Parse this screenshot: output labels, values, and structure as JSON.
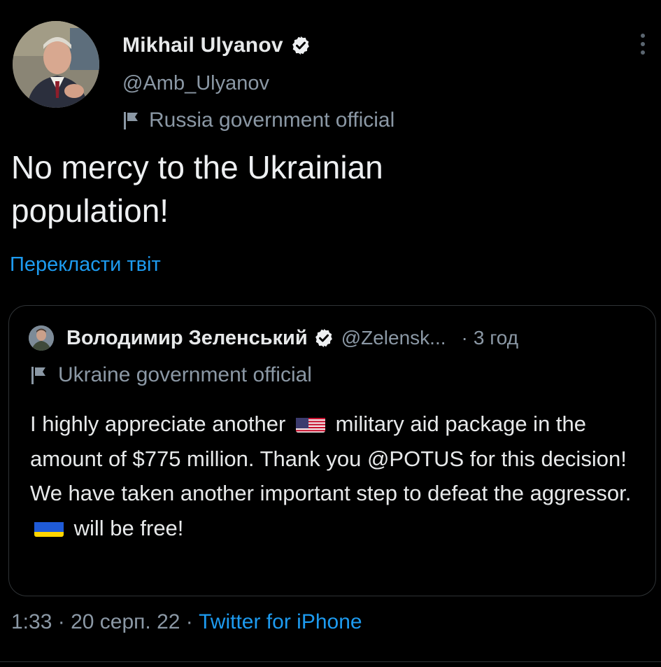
{
  "tweet": {
    "author": {
      "name": "Mikhail Ulyanov",
      "handle": "@Amb_Ulyanov",
      "label": "Russia government official",
      "avatar_icon": "portrait-man-suit"
    },
    "more_icon": "more-vertical-icon",
    "text_lines": [
      "No mercy to the Ukrainian",
      "population!"
    ],
    "translate": "Перекласти твіт",
    "quote": {
      "author": {
        "name": "Володимир Зеленський",
        "handle": "@Zelensk...",
        "label": "Ukraine government official"
      },
      "separator": "·",
      "time": "3 год",
      "text": {
        "p1": "I highly appreciate another",
        "flag_us": "us-flag-emoji",
        "p2": "military aid package in the amount of $775 million. Thank you @POTUS for this decision! We have taken another important step to defeat the aggressor.",
        "flag_ua": "ukraine-flag-emoji",
        "p3": "will be free!"
      }
    },
    "footer": {
      "time": "1:33",
      "separator1": "·",
      "date": "20 серп. 22",
      "separator2": "·",
      "source": "Twitter for iPhone"
    }
  },
  "colors": {
    "background": "#000000",
    "text": "#e7e9ea",
    "secondary": "#8b98a5",
    "link": "#1d9bf0",
    "border": "#2f3336"
  }
}
